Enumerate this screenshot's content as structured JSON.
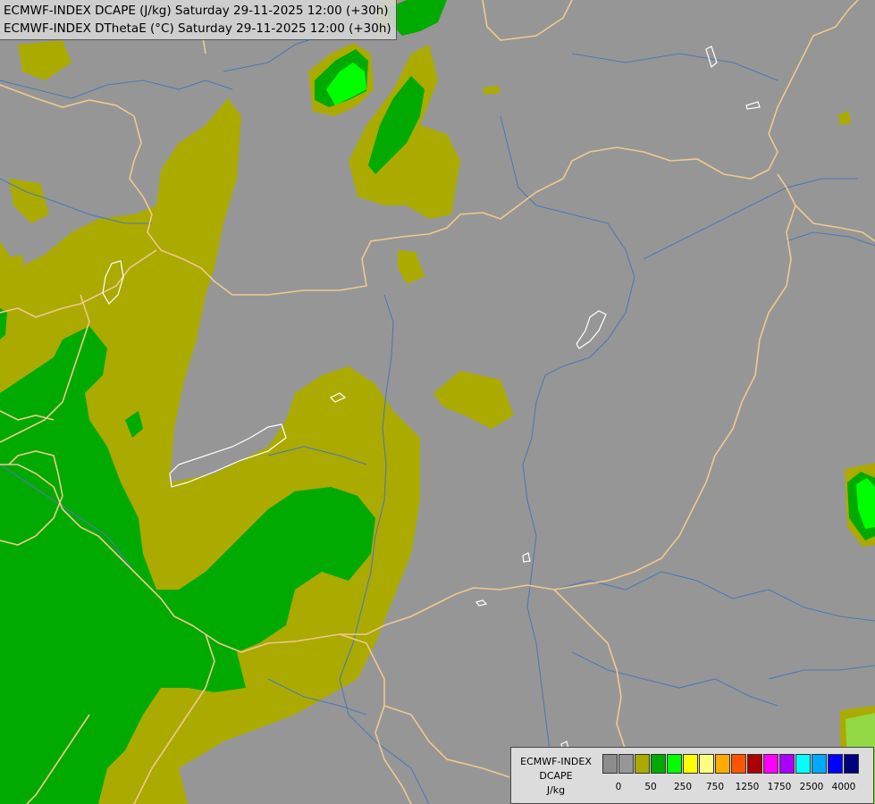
{
  "header": {
    "line1": "ECMWF-INDEX DCAPE (J/kg) Saturday 29-11-2025 12:00 (+30h)",
    "line2": "ECMWF-INDEX DThetaE (°C) Saturday 29-11-2025 12:00 (+30h)"
  },
  "legend": {
    "title_line1": "ECMWF-INDEX",
    "title_line2": "DCAPE",
    "title_line3": "J/kg",
    "colors": [
      "#8c8c8c",
      "#969696",
      "#aaaa00",
      "#00aa00",
      "#00ff00",
      "#ffff00",
      "#ffff80",
      "#ffaa00",
      "#ff5500",
      "#aa0000",
      "#ff00ff",
      "#aa00ff",
      "#00ffff",
      "#00aaff",
      "#0000ff",
      "#00007f"
    ],
    "tick_labels": [
      "0",
      "50",
      "250",
      "750",
      "1250",
      "1750",
      "2500",
      "4000"
    ]
  },
  "colors": {
    "background": "#969696",
    "border": "#f0c890",
    "river": "#5078b4",
    "lake_outline": "#ffffff",
    "level_olive": "#aaaa00",
    "level_green": "#00aa00",
    "level_lime": "#00ff00",
    "level_pale": "#80ff80"
  }
}
